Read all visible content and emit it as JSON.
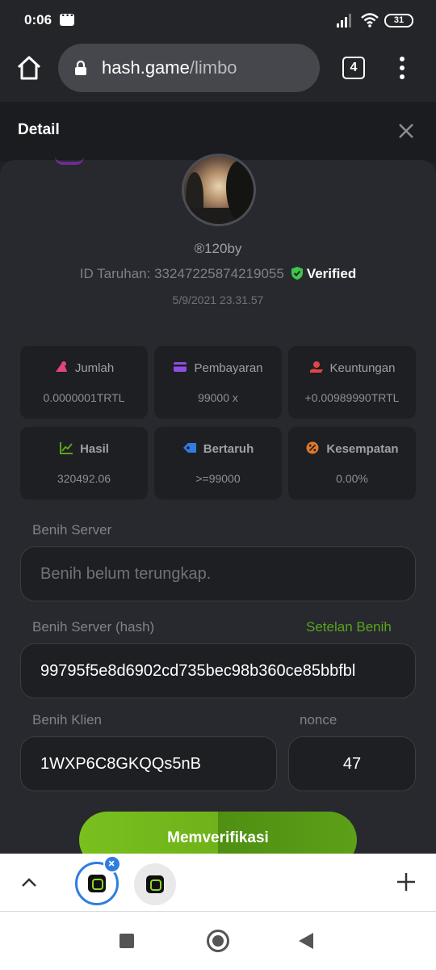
{
  "status_bar": {
    "time": "0:06",
    "battery": "31"
  },
  "browser": {
    "url_host": "hash.game",
    "url_path": "/limbo",
    "tab_count": "4"
  },
  "modal": {
    "title": "Detail",
    "username": "®120by",
    "bet_id_label": "ID Taruhan:",
    "bet_id": "33247225874219055",
    "verified_label": "Verified",
    "datetime": "5/9/2021 23.31.57"
  },
  "stats": [
    {
      "label": "Jumlah",
      "value": "0.0000001TRTL",
      "icon": "coins-icon",
      "color": "#e0457b"
    },
    {
      "label": "Pembayaran",
      "value": "99000 x",
      "icon": "card-icon",
      "color": "#8b4fe0"
    },
    {
      "label": "Keuntungan",
      "value": "+0.00989990TRTL",
      "icon": "hand-money-icon",
      "color": "#e04545"
    },
    {
      "label": "Hasil",
      "value": "320492.06",
      "icon": "chart-icon",
      "color": "#5ca21e"
    },
    {
      "label": "Bertaruh",
      "value": ">=99000",
      "icon": "ticket-icon",
      "color": "#2f7de1"
    },
    {
      "label": "Kesempatan",
      "value": "0.00%",
      "icon": "percent-icon",
      "color": "#e0782a"
    }
  ],
  "seeds": {
    "server_label": "Benih Server",
    "server_placeholder": "Benih belum terungkap.",
    "server_hash_label": "Benih Server (hash)",
    "seed_settings_link": "Setelan Benih",
    "server_hash_value": "99795f5e8d6902cd735bec98b360ce85bbfbl",
    "client_label": "Benih Klien",
    "client_value": "1WXP6C8GKQQs5nB",
    "nonce_label": "nonce",
    "nonce_value": "47"
  },
  "verify_button": "Memverifikasi",
  "colors": {
    "accent": "#5ca21e",
    "verified": "#3ec74a",
    "tab_active": "#2f7de1"
  }
}
